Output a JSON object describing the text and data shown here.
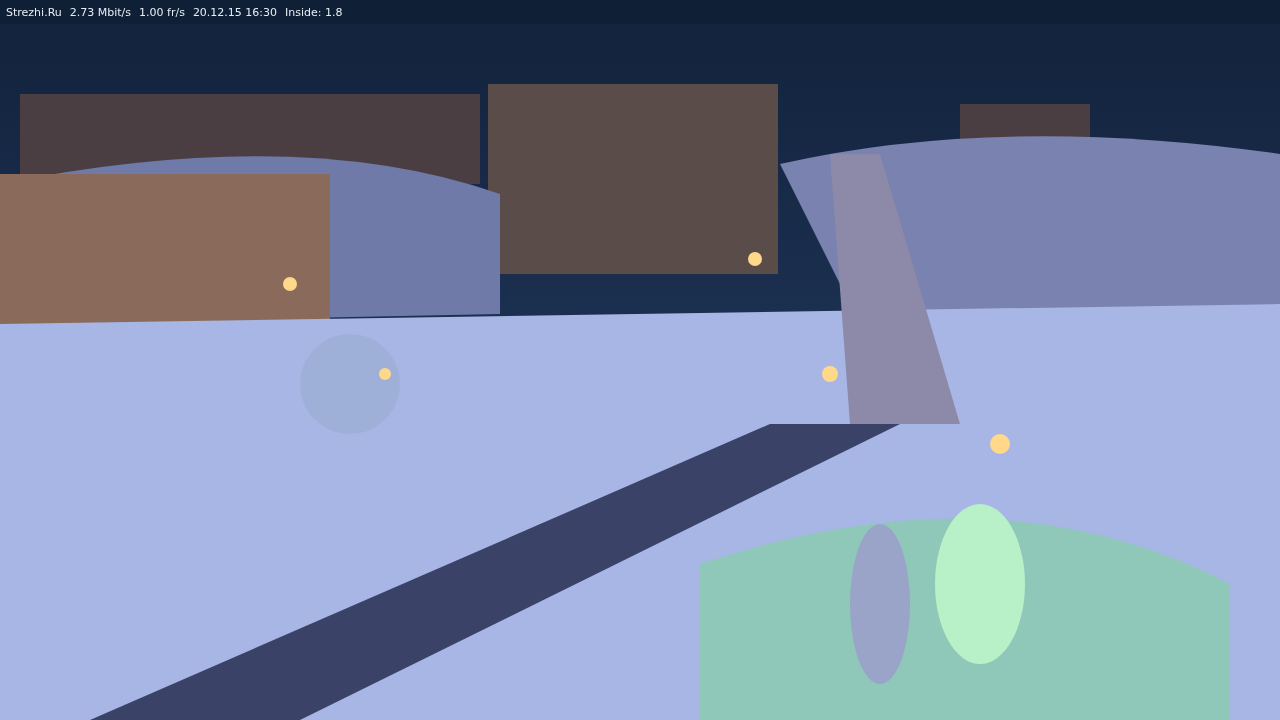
{
  "status_bar": {
    "items": [
      "Strezhi.Ru",
      "2.73 Mbit/s",
      "1.00 fr/s",
      "20.12.15 16:30",
      "Inside: 1.8"
    ]
  }
}
